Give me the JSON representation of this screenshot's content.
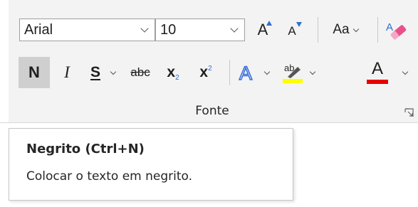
{
  "ribbon": {
    "font_name": "Arial",
    "font_size": "10",
    "grow_font_label": "A",
    "shrink_font_label": "A",
    "change_case_label": "Aa",
    "bold_label": "N",
    "italic_label": "I",
    "underline_label": "S",
    "strikethrough_label": "abc",
    "subscript_label": "x",
    "subscript_mark": "2",
    "superscript_label": "x",
    "superscript_mark": "2",
    "text_effects_label": "A",
    "highlight_label": "ab",
    "font_color_label": "A",
    "group_label": "Fonte"
  },
  "tooltip": {
    "title": "Negrito (Ctrl+N)",
    "description": "Colocar o texto em negrito."
  },
  "colors": {
    "highlight_yellow": "#ffff00",
    "font_color_red": "#e60000",
    "text_effects_blue": "#3a6fd8",
    "accent_blue": "#2f6fd1",
    "eraser_pink": "#e8508a"
  }
}
